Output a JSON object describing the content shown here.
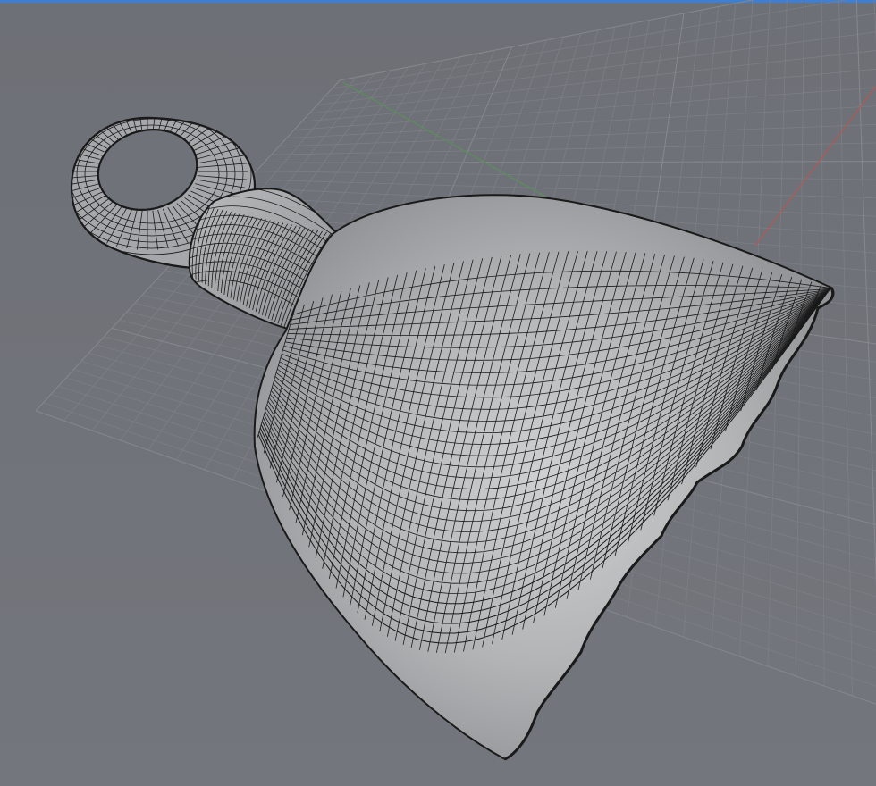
{
  "viewport": {
    "projection": "perspective",
    "display_mode": "wireframe-shaded",
    "active": true
  },
  "colors": {
    "background": "#6f7278",
    "grid_minor": "#7c7f84",
    "grid_major": "#85888d",
    "x_axis": "#b05a55",
    "y_axis": "#5d8c5d",
    "surface_light": "#c9cacc",
    "surface_mid": "#a9aaad",
    "surface_dark": "#8c8d90",
    "isocurve": "#1a1a1a",
    "active_frame": "#3c7fd4"
  },
  "object": {
    "name": "bell",
    "parts": [
      "loop",
      "neck",
      "body",
      "rim"
    ]
  }
}
